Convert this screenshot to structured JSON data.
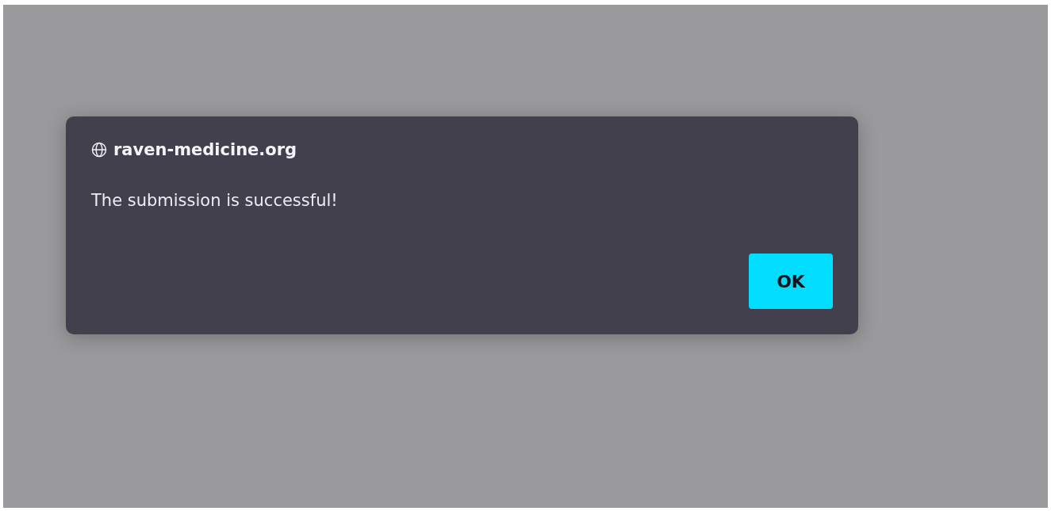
{
  "dialog": {
    "origin": "raven-medicine.org",
    "message": "The submission is successful!",
    "buttons": [
      "OK"
    ]
  }
}
